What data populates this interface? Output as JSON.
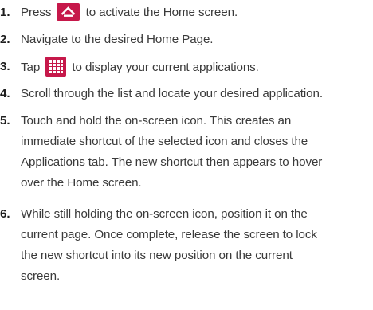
{
  "steps": [
    {
      "number": "1.",
      "before_icon": "Press",
      "icon": "home-icon",
      "after_icon": "to activate the Home screen.",
      "lines": []
    },
    {
      "number": "2.",
      "lines": [
        "Navigate to the desired Home Page."
      ]
    },
    {
      "number": "3.",
      "before_icon": "Tap",
      "icon": "applications-grid-icon",
      "after_icon": "to display your current applications.",
      "lines": []
    },
    {
      "number": "4.",
      "lines": [
        "Scroll through the list and locate your desired application."
      ]
    },
    {
      "number": "5.",
      "lines": [
        "Touch and hold the on-screen icon. This creates an",
        "immediate shortcut of the selected icon and closes the",
        "Applications tab. The new shortcut then appears to hover",
        "over the Home screen."
      ]
    },
    {
      "number": "6.",
      "lines": [
        "While still holding the on-screen icon, position it on the",
        "current page. Once complete, release the screen to lock",
        "the new shortcut into its new position on the current",
        "screen."
      ]
    }
  ],
  "colors": {
    "icon_background": "#c6184a",
    "icon_foreground": "#ffffff",
    "text": "#3a3a3a"
  }
}
